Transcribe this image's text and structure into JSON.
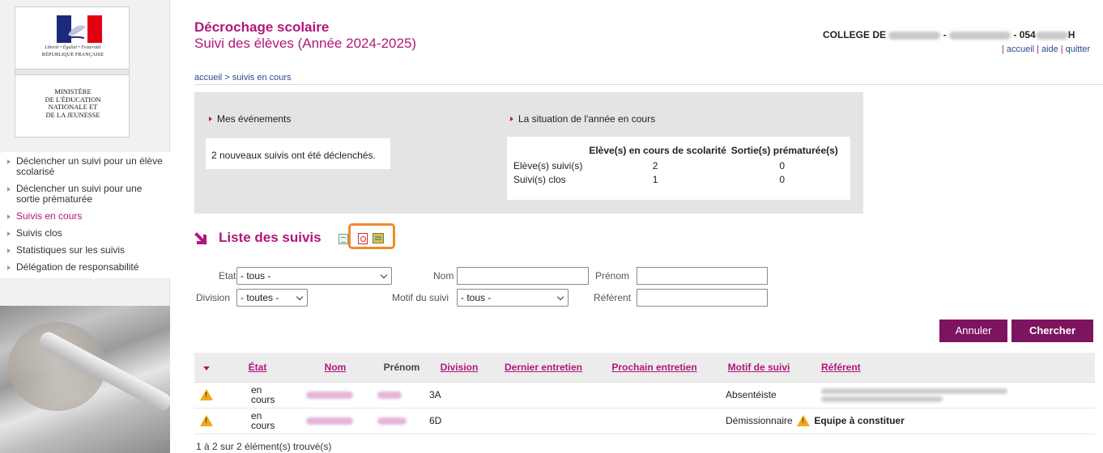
{
  "sidebar": {
    "logo": {
      "devise": "Liberté • Égalité • Fraternité",
      "republique": "RÉPUBLIQUE FRANÇAISE",
      "ministere": "MINISTÈRE\nDE L'ÉDUCATION\nNATIONALE ET\nDE LA JEUNESSE"
    },
    "menu": [
      {
        "label": "Déclencher un suivi pour un élève scolarisé",
        "active": false
      },
      {
        "label": "Déclencher un suivi pour une sortie prématurée",
        "active": false
      },
      {
        "label": "Suivis en cours",
        "active": true
      },
      {
        "label": "Suivis clos",
        "active": false
      },
      {
        "label": "Statistiques sur les suivis",
        "active": false
      },
      {
        "label": "Délégation de responsabilité",
        "active": false
      }
    ]
  },
  "header": {
    "title": "Décrochage scolaire",
    "subtitle": "Suivi des élèves (Année 2024-2025)",
    "college_prefix": "COLLEGE DE",
    "college_code_prefix": "- 054",
    "college_suffix": "H",
    "links": {
      "accueil": "accueil",
      "aide": "aide",
      "quitter": "quitter"
    }
  },
  "breadcrumb": "accueil > suivis en cours",
  "events": {
    "heading": "Mes événements",
    "message": "2 nouveaux suivis ont été déclenchés."
  },
  "situation": {
    "heading": "La situation de l'année en cours",
    "columns": [
      "Elève(s) en cours de scolarité",
      "Sortie(s) prématurée(s)"
    ],
    "rows": [
      {
        "label": "Elève(s) suivi(s)",
        "values": [
          "2",
          "0"
        ]
      },
      {
        "label": "Suivi(s) clos",
        "values": [
          "1",
          "0"
        ]
      }
    ]
  },
  "list": {
    "title": "Liste des suivis"
  },
  "filters": {
    "etat_label": "Etat",
    "etat_value": "- tous -",
    "nom_label": "Nom",
    "prenom_label": "Prénom",
    "division_label": "Division",
    "division_value": "- toutes -",
    "motif_label": "Motif du suivi",
    "motif_value": "- tous -",
    "referent_label": "Référent",
    "annuler": "Annuler",
    "chercher": "Chercher"
  },
  "table": {
    "headers": [
      "État",
      "Nom",
      "Prénom",
      "Division",
      "Dernier entretien",
      "Prochain entretien",
      "Motif de suivi",
      "Référent"
    ],
    "rows": [
      {
        "etat_line1": "en",
        "etat_line2": "cours",
        "division": "3A",
        "motif": "Absentéiste",
        "referent_text": ""
      },
      {
        "etat_line1": "en",
        "etat_line2": "cours",
        "division": "6D",
        "motif": "Démissionnaire",
        "referent_text": "Equipe à constituer"
      }
    ],
    "count_text": "1 à 2 sur 2 élément(s) trouvé(s)"
  },
  "colors": {
    "brand": "#b0177a",
    "button": "#7d1460",
    "panel": "#e4e4e4",
    "highlight": "#f08a2c",
    "warning": "#f0a81c"
  }
}
